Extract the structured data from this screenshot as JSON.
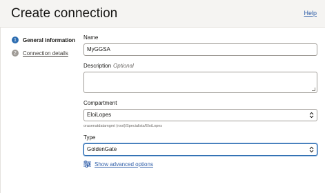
{
  "header": {
    "title": "Create connection",
    "help_label": "Help"
  },
  "steps": [
    {
      "number": "1",
      "label": "General information",
      "state": "active"
    },
    {
      "number": "2",
      "label": "Connection details",
      "state": "inactive"
    }
  ],
  "form": {
    "name": {
      "label": "Name",
      "value": "MyGGSA"
    },
    "description": {
      "label": "Description",
      "optional": "Optional",
      "value": ""
    },
    "compartment": {
      "label": "Compartment",
      "value": "EloiLopes",
      "path": "orasenatdatamgmt (root)/Specialists/EloiLopes"
    },
    "type": {
      "label": "Type",
      "value": "GoldenGate"
    },
    "advanced_label": "Show advanced options"
  },
  "colors": {
    "accent": "#2b6cb0",
    "link": "#2f5ea8",
    "header_bg": "#f5f4f2"
  }
}
